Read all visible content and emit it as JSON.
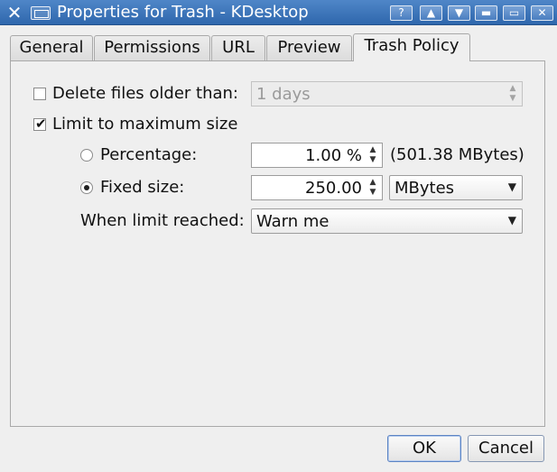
{
  "window": {
    "title": "Properties for Trash - KDesktop",
    "app_icon": "kde-x-icon",
    "title_buttons": {
      "help": "?",
      "shade_up": "▲",
      "shade_down": "▼",
      "minimize": "▬",
      "maximize": "▭",
      "close": "✕"
    }
  },
  "tabs": [
    {
      "label": "General",
      "active": false
    },
    {
      "label": "Permissions",
      "active": false
    },
    {
      "label": "URL",
      "active": false
    },
    {
      "label": "Preview",
      "active": false
    },
    {
      "label": "Trash Policy",
      "active": true
    }
  ],
  "trash_policy": {
    "delete_older": {
      "label": "Delete files older than:",
      "checked": false,
      "value": "1 days",
      "enabled": false
    },
    "limit_size": {
      "label": "Limit to maximum size",
      "checked": true
    },
    "percentage": {
      "label": "Percentage:",
      "selected": false,
      "value": "1.00 %",
      "computed": "(501.38 MBytes)"
    },
    "fixed_size": {
      "label": "Fixed size:",
      "selected": true,
      "value": "250.00",
      "unit": "MBytes"
    },
    "limit_reached": {
      "label": "When limit reached:",
      "value": "Warn me"
    }
  },
  "buttons": {
    "ok": "OK",
    "cancel": "Cancel"
  },
  "glyphs": {
    "tick": "✔",
    "spin": "⌃⌄",
    "chevron": "⌄"
  }
}
